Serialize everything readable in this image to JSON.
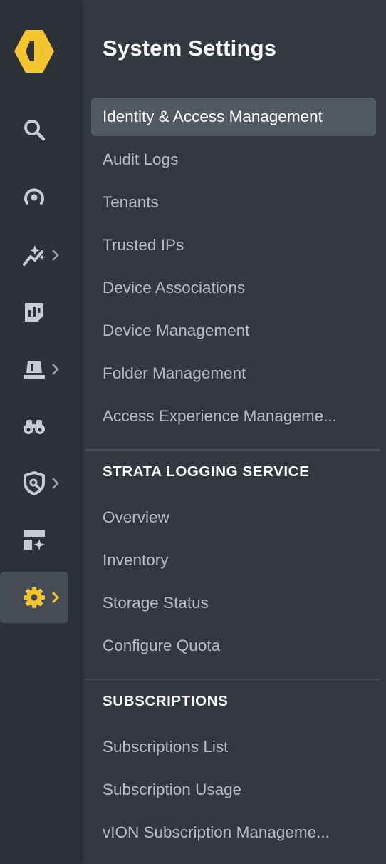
{
  "rail": {
    "logo": "prisma-logo",
    "items": [
      {
        "icon": "search-icon",
        "has_chevron": false
      },
      {
        "icon": "radar-icon",
        "has_chevron": false
      },
      {
        "icon": "insights-icon",
        "has_chevron": true
      },
      {
        "icon": "dashboard-icon",
        "has_chevron": false
      },
      {
        "icon": "alarm-icon",
        "has_chevron": true
      },
      {
        "icon": "binoculars-icon",
        "has_chevron": false
      },
      {
        "icon": "shield-search-icon",
        "has_chevron": true
      },
      {
        "icon": "workflows-icon",
        "has_chevron": false
      },
      {
        "icon": "gear-icon",
        "has_chevron": true,
        "active": true
      }
    ],
    "colors": {
      "accent": "#f4c430",
      "icon": "#c8ccd2"
    }
  },
  "panel": {
    "title": "System Settings",
    "items": [
      "Identity & Access Management",
      "Audit Logs",
      "Tenants",
      "Trusted IPs",
      "Device Associations",
      "Device Management",
      "Folder Management",
      "Access Experience Manageme..."
    ],
    "selected_index": 0,
    "sections": [
      {
        "header": "STRATA LOGGING SERVICE",
        "items": [
          "Overview",
          "Inventory",
          "Storage Status",
          "Configure Quota"
        ]
      },
      {
        "header": "SUBSCRIPTIONS",
        "items": [
          "Subscriptions List",
          "Subscription Usage",
          "vION Subscription Manageme..."
        ]
      }
    ]
  }
}
